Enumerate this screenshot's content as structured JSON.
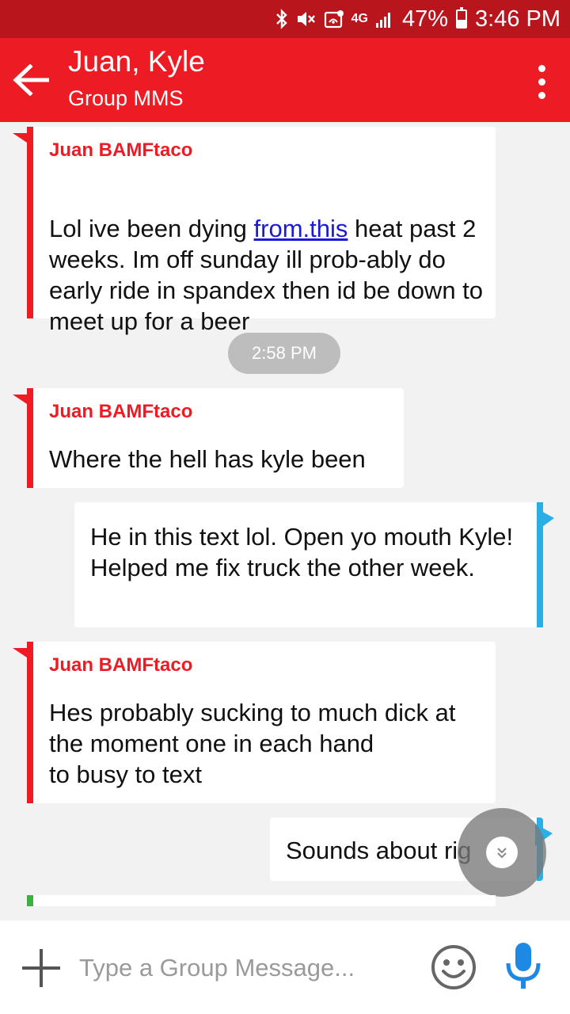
{
  "status_bar": {
    "battery": "47%",
    "time": "3:46 PM",
    "network": "4G",
    "icons": [
      "bluetooth-icon",
      "mute-icon",
      "wifi-calling-icon",
      "lte-icon",
      "signal-icon",
      "battery-icon"
    ]
  },
  "app_bar": {
    "title": "Juan, Kyle",
    "subtitle": "Group MMS"
  },
  "messages": [
    {
      "direction": "incoming",
      "sender": "Juan BAMFtaco",
      "text_before_link": "Lol ive been dying  ",
      "link": "from.this",
      "text_after_link": " heat past 2 weeks. Im off sunday  ill prob-ably do early ride in spandex  then id be down to meet up for a beer"
    },
    {
      "type": "timestamp",
      "text": "2:58 PM"
    },
    {
      "direction": "incoming",
      "sender": "Juan BAMFtaco",
      "text": "Where the  hell has kyle been"
    },
    {
      "direction": "outgoing",
      "text": "He in this text lol. Open yo mouth Kyle!\nHelped me fix truck the other week."
    },
    {
      "direction": "incoming",
      "sender": "Juan BAMFtaco",
      "text": "Hes probably  sucking  to much dick at the moment  one in each hand\nto busy to text"
    },
    {
      "direction": "outgoing",
      "text": "Sounds about rig"
    }
  ],
  "composer": {
    "placeholder": "Type a Group Message..."
  },
  "colors": {
    "status_bar": "#b8161c",
    "app_bar": "#ed1c24",
    "incoming_accent": "#ed1c24",
    "outgoing_accent": "#29aee6",
    "mic": "#1e88e5"
  }
}
